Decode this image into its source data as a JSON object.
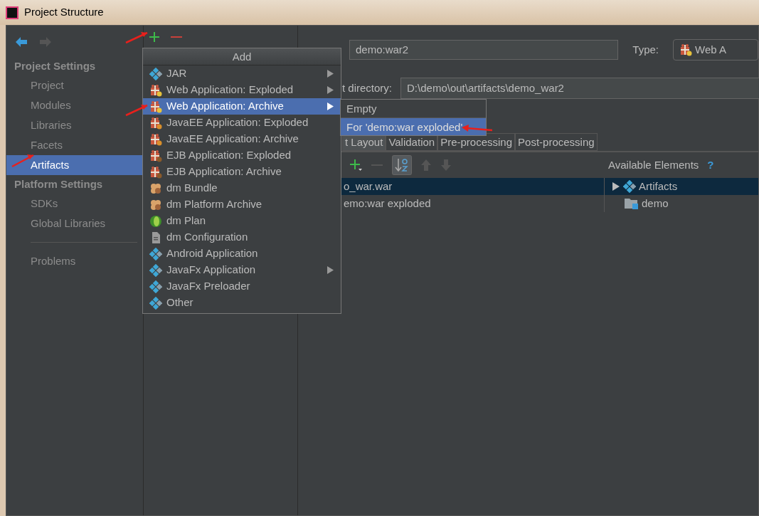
{
  "window": {
    "title": "Project Structure"
  },
  "sidebar": {
    "sections": [
      {
        "heading": "Project Settings",
        "items": [
          {
            "label": "Project",
            "selected": false
          },
          {
            "label": "Modules",
            "selected": false
          },
          {
            "label": "Libraries",
            "selected": false
          },
          {
            "label": "Facets",
            "selected": false
          },
          {
            "label": "Artifacts",
            "selected": true
          }
        ]
      },
      {
        "heading": "Platform Settings",
        "items": [
          {
            "label": "SDKs",
            "selected": false
          },
          {
            "label": "Global Libraries",
            "selected": false
          }
        ]
      }
    ],
    "extra_items": [
      {
        "label": "Problems",
        "selected": false
      }
    ]
  },
  "artifact_form": {
    "name_value": "demo:war2",
    "type_label": "Type:",
    "type_value": "Web A",
    "output_label": "t directory:",
    "output_value": "D:\\demo\\out\\artifacts\\demo_war2"
  },
  "tabs": [
    {
      "label": "t Layout",
      "selected": true
    },
    {
      "label": "Validation",
      "selected": false
    },
    {
      "label": "Pre-processing",
      "selected": false
    },
    {
      "label": "Post-processing",
      "selected": false
    }
  ],
  "layout_tree": [
    {
      "label": "o_war.war",
      "selected": true
    },
    {
      "label": "emo:war exploded",
      "selected": false
    }
  ],
  "available": {
    "heading": "Available Elements",
    "help": "?",
    "items": [
      {
        "label": "Artifacts",
        "kind": "artifacts",
        "selected": true
      },
      {
        "label": "demo",
        "kind": "module",
        "selected": false
      }
    ]
  },
  "add_menu": {
    "title": "Add",
    "items": [
      {
        "label": "JAR",
        "kind": "diamond",
        "submenu": true,
        "selected": false
      },
      {
        "label": "Web Application: Exploded",
        "kind": "web",
        "submenu": true,
        "selected": false
      },
      {
        "label": "Web Application: Archive",
        "kind": "web",
        "submenu": true,
        "selected": true
      },
      {
        "label": "JavaEE Application: Exploded",
        "kind": "javaee",
        "submenu": false,
        "selected": false
      },
      {
        "label": "JavaEE Application: Archive",
        "kind": "javaee",
        "submenu": false,
        "selected": false
      },
      {
        "label": "EJB Application: Exploded",
        "kind": "ejb",
        "submenu": false,
        "selected": false
      },
      {
        "label": "EJB Application: Archive",
        "kind": "ejb",
        "submenu": false,
        "selected": false
      },
      {
        "label": "dm Bundle",
        "kind": "bundle",
        "submenu": false,
        "selected": false
      },
      {
        "label": "dm Platform Archive",
        "kind": "bundle",
        "submenu": false,
        "selected": false
      },
      {
        "label": "dm Plan",
        "kind": "plan",
        "submenu": false,
        "selected": false
      },
      {
        "label": "dm Configuration",
        "kind": "config",
        "submenu": false,
        "selected": false
      },
      {
        "label": "Android Application",
        "kind": "diamond",
        "submenu": false,
        "selected": false
      },
      {
        "label": "JavaFx Application",
        "kind": "diamond",
        "submenu": true,
        "selected": false
      },
      {
        "label": "JavaFx Preloader",
        "kind": "diamond",
        "submenu": false,
        "selected": false
      },
      {
        "label": "Other",
        "kind": "diamond",
        "submenu": false,
        "selected": false
      }
    ]
  },
  "submenu": {
    "items": [
      {
        "label": "Empty",
        "selected": false
      },
      {
        "label": "For 'demo:war exploded'",
        "selected": true
      }
    ]
  }
}
